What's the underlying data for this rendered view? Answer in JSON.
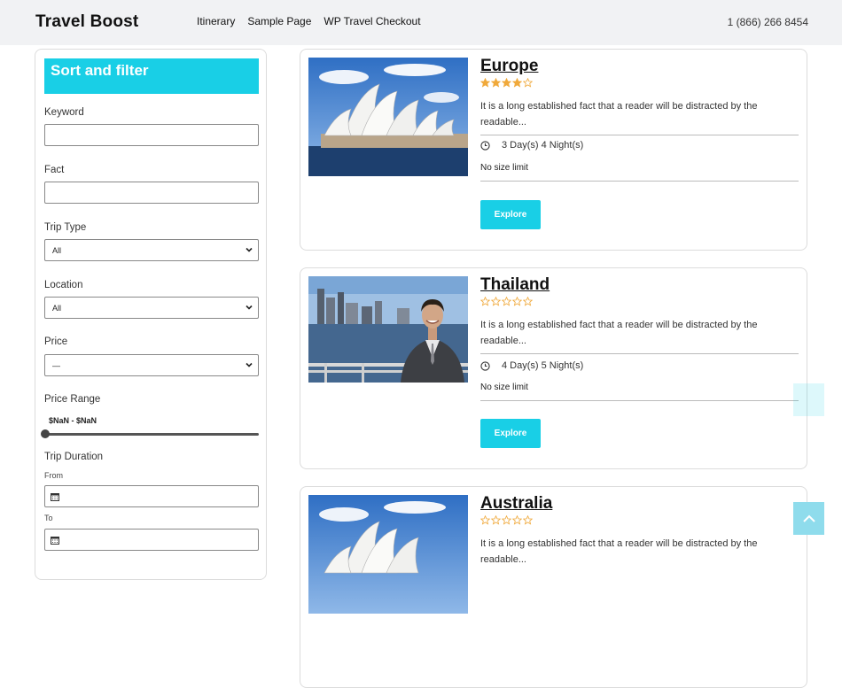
{
  "header": {
    "brand": "Travel Boost",
    "nav": [
      "Itinerary",
      "Sample Page",
      "WP Travel Checkout"
    ],
    "phone": "1 (866) 266 8454"
  },
  "filter": {
    "title": "Sort and filter",
    "keyword_label": "Keyword",
    "keyword_value": "",
    "fact_label": "Fact",
    "fact_value": "",
    "trip_type_label": "Trip Type",
    "trip_type_value": "All",
    "location_label": "Location",
    "location_value": "All",
    "price_label": "Price",
    "price_value": "—",
    "price_range_label": "Price Range",
    "price_range_value": "$NaN - $NaN",
    "trip_duration_label": "Trip Duration",
    "from_label": "From",
    "to_label": "To"
  },
  "trips": [
    {
      "title": "Europe",
      "rating": 4,
      "description": "It is a long established fact that a reader will be distracted by the readable...",
      "duration": "3 Day(s) 4 Night(s)",
      "size": "No size limit",
      "button": "Explore",
      "image": "opera-house"
    },
    {
      "title": "Thailand",
      "rating": 0,
      "description": "It is a long established fact that a reader will be distracted by the readable...",
      "duration": "4 Day(s) 5 Night(s)",
      "size": "No size limit",
      "button": "Explore",
      "image": "man-harbor"
    },
    {
      "title": "Australia",
      "rating": 0,
      "description": "It is a long established fact that a reader will be distracted by the readable...",
      "duration": "",
      "size": "",
      "button": "",
      "image": "opera-house"
    }
  ],
  "colors": {
    "accent": "#19cfe6",
    "star": "#f0a93b"
  }
}
